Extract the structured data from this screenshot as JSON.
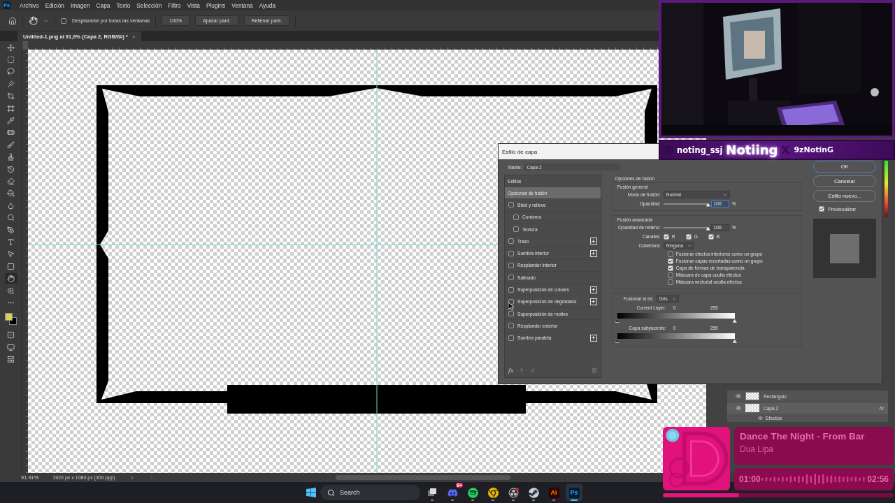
{
  "app": {
    "logo": "Ps",
    "menu": [
      "Archivo",
      "Edición",
      "Imagen",
      "Capa",
      "Texto",
      "Selección",
      "Filtro",
      "Vista",
      "Plugins",
      "Ventana",
      "Ayuda"
    ]
  },
  "options_bar": {
    "scroll_all": {
      "label": "Desplazarse por todas las ventanas",
      "checked": false
    },
    "buttons": [
      "100%",
      "Ajustar pant.",
      "Rellenar pant."
    ]
  },
  "document_tab": {
    "title": "Untitled-1.png al 91,9% (Capa 2, RGB/8#) *",
    "close": "×"
  },
  "tools": [
    {
      "kind": "move",
      "selected": false
    },
    {
      "kind": "marquee",
      "selected": false
    },
    {
      "kind": "lasso",
      "selected": false
    },
    {
      "kind": "wand",
      "selected": false
    },
    {
      "kind": "crop",
      "selected": false
    },
    {
      "kind": "frame",
      "selected": false
    },
    {
      "kind": "eyedropper",
      "selected": false
    },
    {
      "kind": "healing",
      "selected": false
    },
    {
      "kind": "brush",
      "selected": false
    },
    {
      "kind": "stamp",
      "selected": false
    },
    {
      "kind": "history",
      "selected": false
    },
    {
      "kind": "eraser",
      "selected": false
    },
    {
      "kind": "bucket",
      "selected": false
    },
    {
      "kind": "blur",
      "selected": false
    },
    {
      "kind": "dodge",
      "selected": false
    },
    {
      "kind": "pen",
      "selected": false
    },
    {
      "kind": "type",
      "selected": false
    },
    {
      "kind": "path",
      "selected": false
    },
    {
      "kind": "rectangle",
      "selected": false
    },
    {
      "kind": "hand",
      "selected": true
    },
    {
      "kind": "zoom",
      "selected": false
    },
    {
      "kind": "more",
      "selected": false
    }
  ],
  "more_tools": [
    {
      "kind": "quickmask",
      "selected": false
    },
    {
      "kind": "screen",
      "selected": false
    },
    {
      "kind": "artboard",
      "selected": false
    }
  ],
  "layers": [
    {
      "name": "Rectangulo",
      "selected": false,
      "fx": false
    },
    {
      "name": "Capa 2",
      "selected": true,
      "fx": true,
      "fx_label": "fx"
    }
  ],
  "effects_label": "Efectos",
  "status_bar": {
    "zoom": "91.91%",
    "info": "1920 px x 1080 px (300 ppp)"
  },
  "dialog": {
    "title": "Estilo de capa",
    "name_label": "Name:",
    "name_value": "Capa 2",
    "styles_header": "Estilos",
    "styles": [
      {
        "label": "Opciones de fusión",
        "kind": "plain",
        "selected": true
      },
      {
        "label": "Bisel y relieve",
        "kind": "check",
        "checked": false,
        "selected": false,
        "add": false
      },
      {
        "label": "Contorno",
        "kind": "sub",
        "checked": false,
        "selected": false,
        "add": false
      },
      {
        "label": "Textura",
        "kind": "sub",
        "checked": false,
        "selected": false,
        "add": false
      },
      {
        "label": "Trazo",
        "kind": "check",
        "checked": false,
        "selected": false,
        "add": true
      },
      {
        "label": "Sombra interior",
        "kind": "check",
        "checked": false,
        "selected": false,
        "add": true
      },
      {
        "label": "Resplandor interior",
        "kind": "check",
        "checked": false,
        "selected": false,
        "add": false
      },
      {
        "label": "Satinado",
        "kind": "check",
        "checked": false,
        "selected": false,
        "add": false
      },
      {
        "label": "Superposición de colores",
        "kind": "check",
        "checked": false,
        "selected": false,
        "add": true
      },
      {
        "label": "Superposición de degradado",
        "kind": "check",
        "checked": false,
        "selected": false,
        "add": true
      },
      {
        "label": "Superposición de motivo",
        "kind": "check",
        "checked": false,
        "selected": false,
        "add": false
      },
      {
        "label": "Resplandor exterior",
        "kind": "check",
        "checked": false,
        "selected": false,
        "add": false
      },
      {
        "label": "Sombra paralela",
        "kind": "check",
        "checked": false,
        "selected": false,
        "add": true
      }
    ],
    "fx_label": "fx",
    "blend_title": "Opciones de fusión",
    "general": {
      "title": "Fusión general",
      "mode_label": "Modo de fusión:",
      "mode": "Normal",
      "opacity_label": "Opacidad:",
      "opacity": "100",
      "opacity_focused": true,
      "opacity_slider": {
        "level": 1
      },
      "unit": "%"
    },
    "advanced": {
      "title": "Fusión avanzada",
      "fill_label": "Opacidad de relleno:",
      "fill": "100",
      "fill_slider": {
        "level": 1
      },
      "unit": "%",
      "channels_label": "Canales:",
      "channels": [
        {
          "label": "R",
          "checked": true
        },
        {
          "label": "G",
          "checked": true
        },
        {
          "label": "B",
          "checked": true
        }
      ],
      "knockout_label": "Cobertura:",
      "knockout": "Ninguna",
      "options": [
        {
          "label": "Fusionar efectos interiores como un grupo",
          "checked": false
        },
        {
          "label": "Fusionar capas recortadas como un grupo",
          "checked": true
        },
        {
          "label": "Capa de formas de transparencia",
          "checked": true
        },
        {
          "label": "Máscara de capa oculta efectos",
          "checked": false
        },
        {
          "label": "Máscara vectorial oculta efectos",
          "checked": false
        }
      ]
    },
    "blend_if": {
      "label": "Fusionar si es:",
      "value": "Gris",
      "bars": [
        {
          "label": "Current Layer:",
          "low": "0",
          "high": "255"
        },
        {
          "label": "Capa subyacente:",
          "low": "0",
          "high": "255"
        }
      ]
    },
    "buttons": [
      {
        "label": "OK",
        "selected": true
      },
      {
        "label": "Cancelar",
        "selected": false
      },
      {
        "label": "Estilo nuevo...",
        "selected": false
      }
    ],
    "preview": {
      "label": "Previsualizar",
      "checked": true
    }
  },
  "stream_overlay": {
    "instagram": "noting_ssj",
    "title": "Notiing",
    "x_handle": "9zNotinG"
  },
  "now_playing": {
    "title": "Dance The Night - From Bar",
    "artist": "Dua Lipa",
    "elapsed": "01:00",
    "duration": "02:56",
    "level": 0.33
  },
  "taskbar": {
    "search": "Search",
    "apps": [
      {
        "kind": "taskview",
        "selected": false
      },
      {
        "kind": "discord",
        "badge": "9+",
        "selected": false
      },
      {
        "kind": "spotify",
        "selected": false
      },
      {
        "kind": "chrome",
        "selected": false
      },
      {
        "kind": "obs",
        "selected": false
      },
      {
        "kind": "steam",
        "selected": false
      },
      {
        "kind": "illustrator",
        "label": "Ai",
        "selected": false
      },
      {
        "kind": "photoshop",
        "label": "Ps",
        "selected": true
      }
    ]
  }
}
